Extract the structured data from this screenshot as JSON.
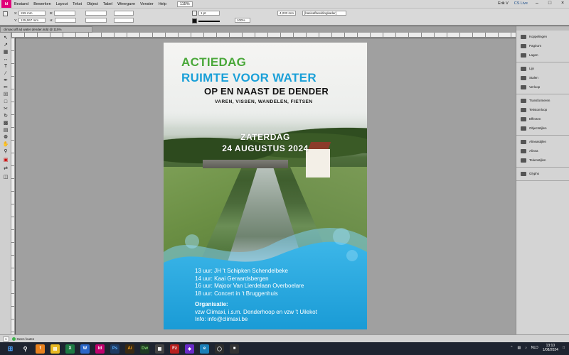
{
  "menu": {
    "items": [
      "Bestand",
      "Bewerken",
      "Layout",
      "Tekst",
      "Object",
      "Tabel",
      "Weergave",
      "Venster",
      "Help"
    ],
    "zoom": "115%",
    "user": "Erik V",
    "cslive": "CS Live"
  },
  "control": {
    "x_label": "X:",
    "x_value": "245 mm",
    "y_label": "Y:",
    "y_value": "125,067 mm",
    "w_label": "B:",
    "h_label": "H:",
    "stroke_weight": "1 pt",
    "opacity": "100%",
    "size_value": "4,233 mm",
    "frame_style": "[basisafbeeldingkader]"
  },
  "document": {
    "tab_title": "climaxi aff ad water dender.indd @ 115%"
  },
  "tools": [
    "pointer-tool",
    "direct-select-tool",
    "page-tool",
    "gap-tool",
    "type-tool",
    "line-tool",
    "pen-tool",
    "pencil-tool",
    "rect-frame-tool",
    "rect-tool",
    "scissors-tool",
    "transform-tool",
    "gradient-tool",
    "note-tool",
    "eyedropper-tool",
    "hand-tool",
    "zoom-tool",
    "fill-stroke-tool",
    "swap-tool",
    "mode-tool"
  ],
  "poster": {
    "line1": "ACTIEDAG",
    "line2": "RUIMTE VOOR WATER",
    "line3": "OP EN NAAST DE DENDER",
    "subtitle": "VAREN, VISSEN, WANDELEN, FIETSEN",
    "date1": "ZATERDAG",
    "date2": "24 AUGUSTUS 2024",
    "schedule": [
      "13 uur: JH 't Schipken Schendelbeke",
      "14 uur: Kaai Geraardsbergen",
      "16 uur: Majoor Van Lierdelaan Overboelare",
      "18 uur: Concert in 't Bruggenhuis"
    ],
    "org_label": "Organisatie:",
    "org_text": "vzw Climaxi, i.s.m. Denderhoop en vzw 't Uilekot",
    "info": "Info: info@climaxi.be",
    "colors": {
      "green": "#4aa83a",
      "blue": "#1aa0d8"
    }
  },
  "panels": {
    "groups": [
      [
        "Koppelingen",
        "Pagina's",
        "Lagen"
      ],
      [
        "Lijn",
        "Stalen",
        "Verloop"
      ],
      [
        "Transformeren",
        "Tekstomloop",
        "Effecten",
        "Objectstijlen"
      ],
      [
        "Alineastijlen",
        "Alinea",
        "Tekenstijlen"
      ],
      [
        "Glyphs"
      ]
    ]
  },
  "status": {
    "page": "1",
    "preflight": "Geen fouten"
  },
  "taskbar": {
    "lang": "NLD",
    "time": "13:10",
    "date": "1/08/2024"
  }
}
